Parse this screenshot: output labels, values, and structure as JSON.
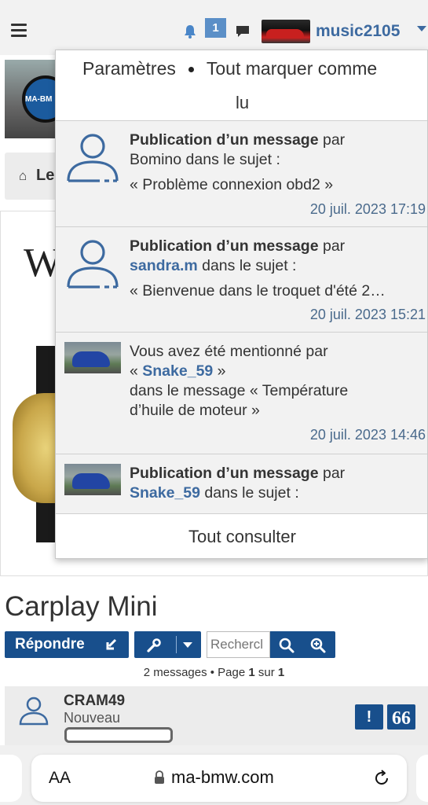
{
  "header": {
    "notification_count": "1",
    "username": "music2105",
    "icons": [
      "menu-icon",
      "bell-icon",
      "chat-icon",
      "avatar"
    ]
  },
  "background": {
    "logo_text": "MA-BM",
    "home_label": "Le",
    "ad_letter": "W",
    "topic_title": "Carplay Mini",
    "reply_label": "Répondre",
    "search_placeholder": "Rechercl",
    "pagination": {
      "prefix": "2 messages • Page ",
      "page": "1",
      "middle": " sur ",
      "total": "1"
    },
    "post": {
      "author": "CRAM49",
      "rank": "Nouveau",
      "report_label": "!",
      "quote_label": "66"
    }
  },
  "notifications": {
    "settings_label": "Paramètres",
    "mark_all_label": "Tout marquer comme",
    "mark_all_label_2": "lu",
    "view_all_label": "Tout consulter",
    "items": [
      {
        "title": "Publication d’un message",
        "by": " par",
        "author": "Bomino",
        "in_topic": " dans le sujet :",
        "topic": "« Problème connexion obd2 »",
        "time": "20 juil. 2023 17:19"
      },
      {
        "title": "Publication d’un message",
        "by": " par",
        "author": "sandra.m",
        "in_topic": " dans le sujet :",
        "topic": "« Bienvenue dans le troquet d'été 2…",
        "time": "20 juil. 2023 15:21"
      },
      {
        "intro": "Vous avez été mentionné par",
        "quote_open": "« ",
        "author": "Snake_59",
        "quote_close": " »",
        "context": "dans le message « Température",
        "context_2": "d’huile de moteur »",
        "time": "20 juil. 2023 14:46"
      },
      {
        "title": "Publication d’un message",
        "by": " par",
        "author": "Snake_59",
        "in_topic": " dans le sujet :"
      }
    ]
  },
  "browser": {
    "text_size_label": "AA",
    "url": "ma-bmw.com"
  },
  "colors": {
    "brand_blue": "#184f8c",
    "link_blue": "#3d6aa0",
    "badge_blue": "#5b8fc7"
  }
}
